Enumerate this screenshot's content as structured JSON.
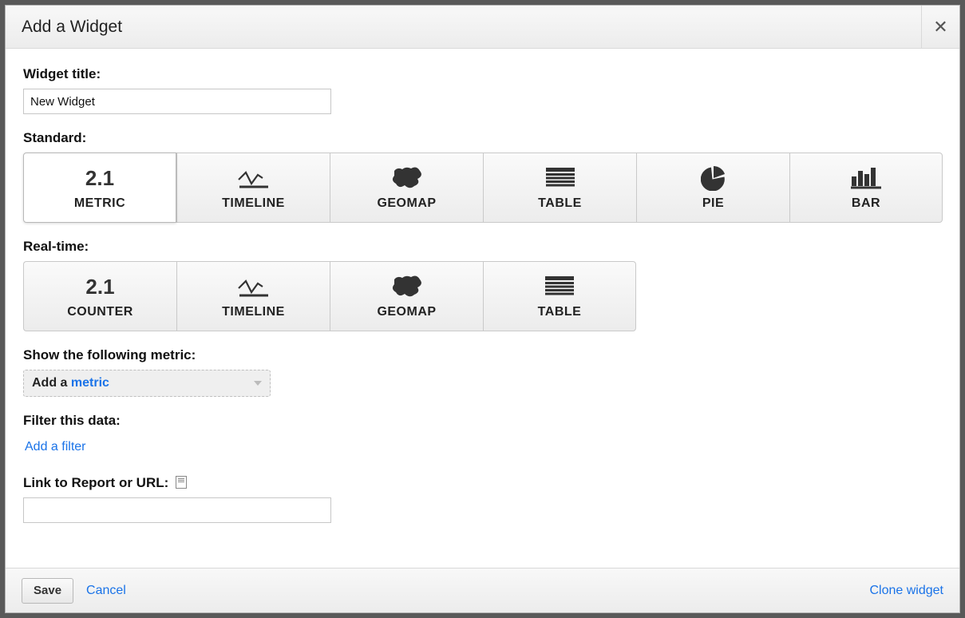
{
  "dialog": {
    "title": "Add a Widget"
  },
  "widget_title": {
    "label": "Widget title:",
    "value": "New Widget"
  },
  "standard": {
    "label": "Standard:",
    "tiles": [
      {
        "label": "METRIC",
        "icon_text": "2.1",
        "selected": true
      },
      {
        "label": "TIMELINE"
      },
      {
        "label": "GEOMAP"
      },
      {
        "label": "TABLE"
      },
      {
        "label": "PIE"
      },
      {
        "label": "BAR"
      }
    ]
  },
  "realtime": {
    "label": "Real-time:",
    "tiles": [
      {
        "label": "COUNTER",
        "icon_text": "2.1"
      },
      {
        "label": "TIMELINE"
      },
      {
        "label": "GEOMAP"
      },
      {
        "label": "TABLE"
      }
    ]
  },
  "metric": {
    "label": "Show the following metric:",
    "prefix": "Add a ",
    "link": "metric"
  },
  "filter": {
    "label": "Filter this data:",
    "link": "Add a filter"
  },
  "link_report": {
    "label": "Link to Report or URL:",
    "value": ""
  },
  "footer": {
    "save": "Save",
    "cancel": "Cancel",
    "clone": "Clone widget"
  }
}
